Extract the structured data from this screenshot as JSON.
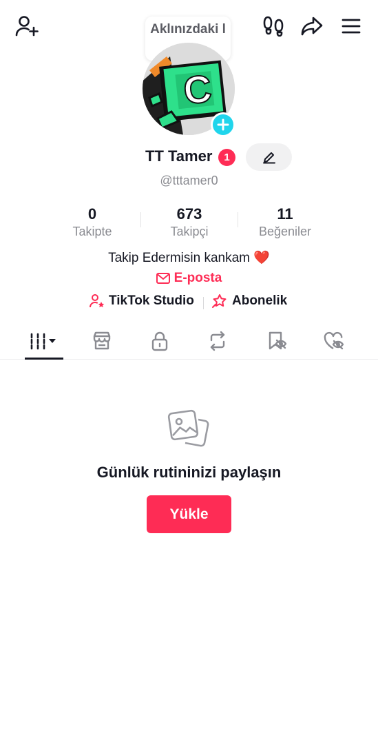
{
  "header": {
    "status_bubble": "Aklınızdaki ler..."
  },
  "profile": {
    "display_name": "TT Tamer",
    "notification_count": "1",
    "username": "@tttamer0",
    "bio": "Takip Edermisin kankam ❤️",
    "email_label": "E-posta"
  },
  "stats": [
    {
      "value": "0",
      "label": "Takipte"
    },
    {
      "value": "673",
      "label": "Takipçi"
    },
    {
      "value": "11",
      "label": "Beğeniler"
    }
  ],
  "links": {
    "studio_label": "TikTok Studio",
    "subscription_label": "Abonelik"
  },
  "tabs": [
    {
      "icon": "videos-grid-icon",
      "active": true
    },
    {
      "icon": "shop-icon",
      "active": false
    },
    {
      "icon": "lock-icon",
      "active": false
    },
    {
      "icon": "repost-icon",
      "active": false
    },
    {
      "icon": "favorites-hidden-icon",
      "active": false
    },
    {
      "icon": "liked-hidden-icon",
      "active": false
    }
  ],
  "empty_state": {
    "title": "Günlük rutininizi paylaşın",
    "button_label": "Yükle"
  },
  "colors": {
    "accent": "#fe2c55",
    "plus_badge": "#20d5ec",
    "text": "#161823",
    "secondary_text": "#8a8b91"
  }
}
